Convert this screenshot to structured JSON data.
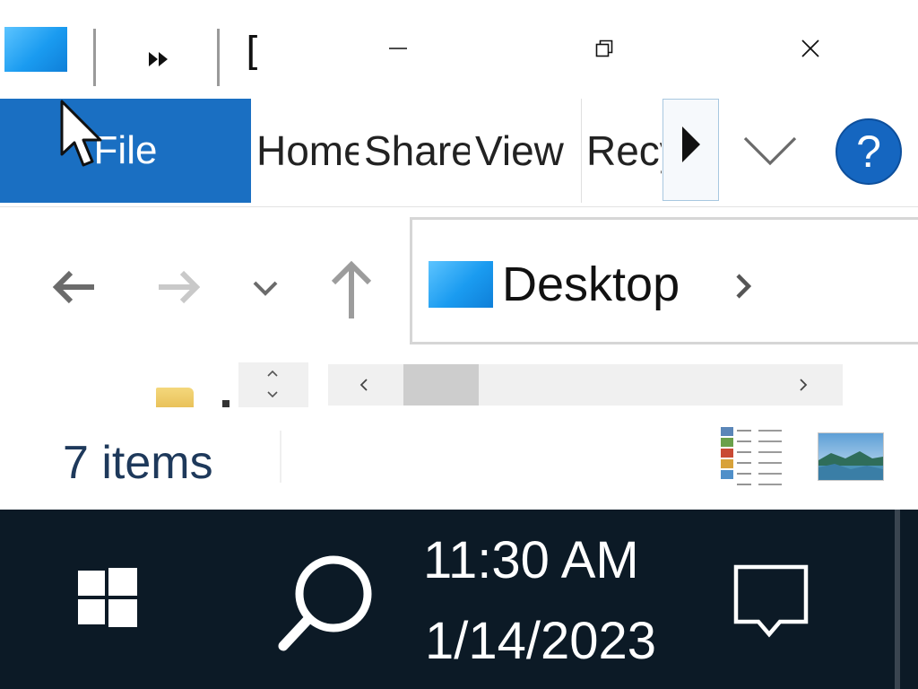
{
  "title_bar": {
    "truncated_title": "[",
    "icons": {
      "app": "desktop-folder-icon",
      "more": "double-chevron-right-icon",
      "minimize": "minimize-icon",
      "restore": "restore-icon",
      "close": "close-icon"
    }
  },
  "ribbon": {
    "tabs": [
      {
        "label": "File"
      },
      {
        "label": "Home"
      },
      {
        "label": "Share"
      },
      {
        "label": "View"
      },
      {
        "label": "Recycle Bin Tools"
      }
    ],
    "help_label": "?",
    "icons": {
      "scroll": "triangle-right-icon",
      "expand": "chevron-down-icon"
    },
    "file_tab_color": "#1a6fc2"
  },
  "navigation": {
    "icons": {
      "back": "arrow-left-icon",
      "forward": "arrow-right-icon",
      "recent": "chevron-down-icon",
      "up": "arrow-up-icon"
    },
    "address": {
      "location": "Desktop",
      "icon": "desktop-folder-icon",
      "separator_icon": "chevron-right-icon"
    }
  },
  "scrollbars": {
    "icons": {
      "up": "chevron-up-icon",
      "down": "chevron-down-icon",
      "left": "chevron-left-icon",
      "right": "chevron-right-icon"
    }
  },
  "status_bar": {
    "item_count": "7 items",
    "views": {
      "details": "details-view-icon",
      "large_icons": "large-icons-view-icon"
    }
  },
  "taskbar": {
    "time": "11:30 AM",
    "date": "1/14/2023",
    "icons": {
      "start": "windows-logo-icon",
      "search": "search-icon",
      "notifications": "action-center-icon"
    },
    "background": "#0c1a26"
  }
}
